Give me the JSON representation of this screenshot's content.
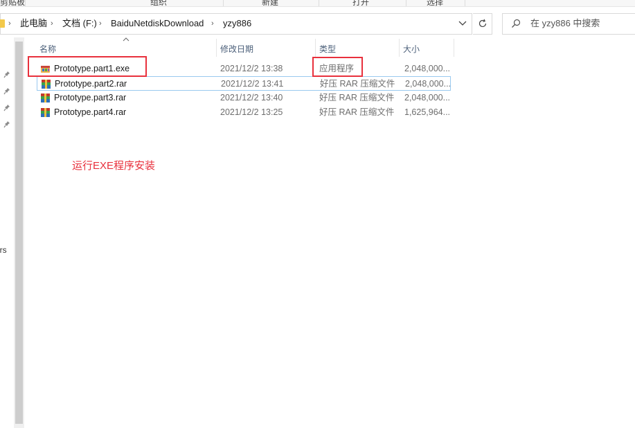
{
  "ribbon": {
    "groups": [
      "剪贴板",
      "组织",
      "新建",
      "打开",
      "选择"
    ]
  },
  "breadcrumb": {
    "items": [
      "此电脑",
      "文档 (F:)",
      "BaiduNetdiskDownload",
      "yzy886"
    ]
  },
  "search": {
    "placeholder": "在 yzy886 中搜索"
  },
  "nav": {
    "partial_label": "ers"
  },
  "columns": {
    "name": "名称",
    "date": "修改日期",
    "type": "类型",
    "size": "大小"
  },
  "files": [
    {
      "name": "Prototype.part1.exe",
      "date": "2021/12/2 13:38",
      "type": "应用程序",
      "size": "2,048,000...",
      "icon": "app-exe-icon"
    },
    {
      "name": "Prototype.part2.rar",
      "date": "2021/12/2 13:41",
      "type": "好压 RAR 压缩文件",
      "size": "2,048,000...",
      "icon": "rar-archive-icon"
    },
    {
      "name": "Prototype.part3.rar",
      "date": "2021/12/2 13:40",
      "type": "好压 RAR 压缩文件",
      "size": "2,048,000...",
      "icon": "rar-archive-icon"
    },
    {
      "name": "Prototype.part4.rar",
      "date": "2021/12/2 13:25",
      "type": "好压 RAR 压缩文件",
      "size": "1,625,964...",
      "icon": "rar-archive-icon"
    }
  ],
  "annotation": {
    "text": "运行EXE程序安装",
    "color": "#e8303c"
  }
}
